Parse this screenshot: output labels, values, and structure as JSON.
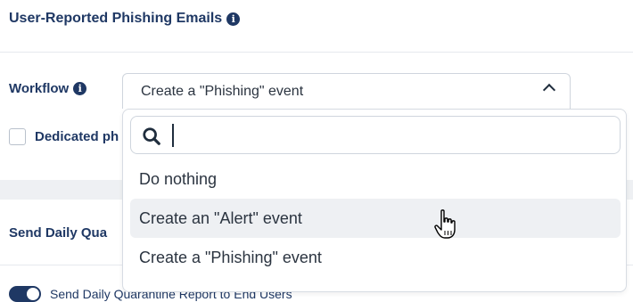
{
  "section": {
    "title": "User-Reported Phishing Emails",
    "info_icon": "i"
  },
  "workflow": {
    "label": "Workflow",
    "info_icon": "i",
    "selected": "Create a \"Phishing\" event"
  },
  "dedicated": {
    "label": "Dedicated ph"
  },
  "daily": {
    "title": "Send Daily Qua",
    "toggle_label": "Send Daily Quarantine Report to End Users"
  },
  "dropdown": {
    "search_value": "",
    "options": [
      "Do nothing",
      "Create an \"Alert\" event",
      "Create a \"Phishing\" event"
    ],
    "hovered_index": 1
  },
  "icons": {
    "info": "info-icon",
    "search": "search-icon",
    "chevron": "chevron-up-icon",
    "cursor": "hand-pointer-icon"
  },
  "colors": {
    "navy": "#1f3864",
    "hover": "#eef0f3",
    "border": "#cfd5dd"
  }
}
